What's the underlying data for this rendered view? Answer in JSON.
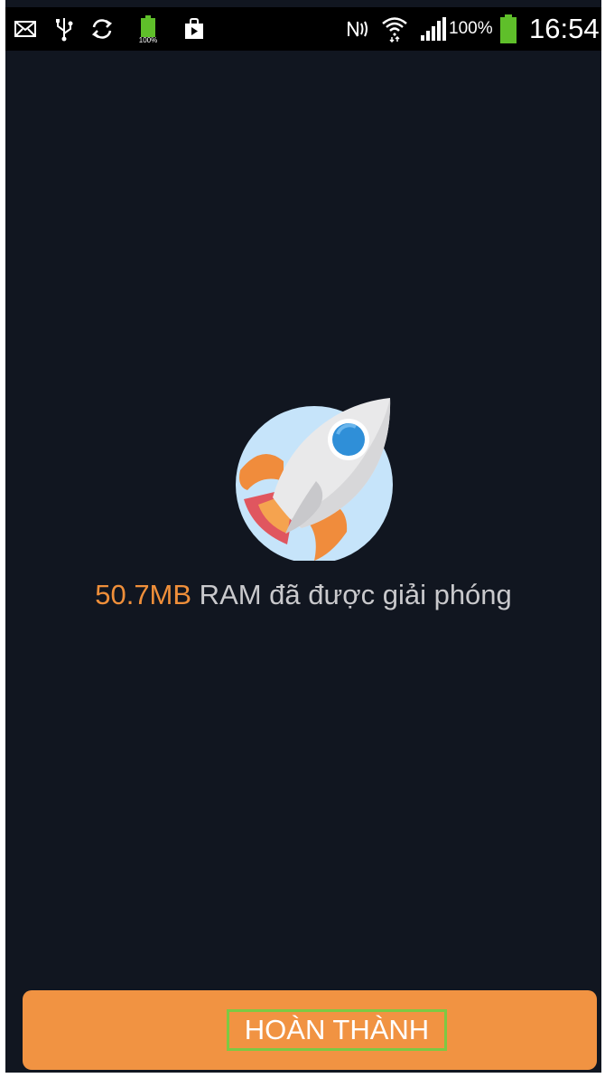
{
  "status_bar": {
    "battery_percent_label": "100%",
    "battery_level_percent": 100,
    "mini_battery_label": "100%",
    "time": "16:54",
    "icons": [
      "mail-icon",
      "usb-icon",
      "sync-icon",
      "battery-full-icon",
      "play-store-icon",
      "nfc-icon",
      "wifi-icon",
      "signal-icon",
      "battery-icon"
    ]
  },
  "main": {
    "freed_amount": "50.7MB",
    "message_rest": " RAM đã được giải phóng",
    "illustration": "rocket-icon"
  },
  "footer": {
    "done_label": "HOÀN THÀNH"
  },
  "colors": {
    "background": "#111620",
    "accent": "#ef8f3a",
    "button": "#f19342",
    "highlight_border": "#7dc943",
    "status_bar": "#000000"
  }
}
